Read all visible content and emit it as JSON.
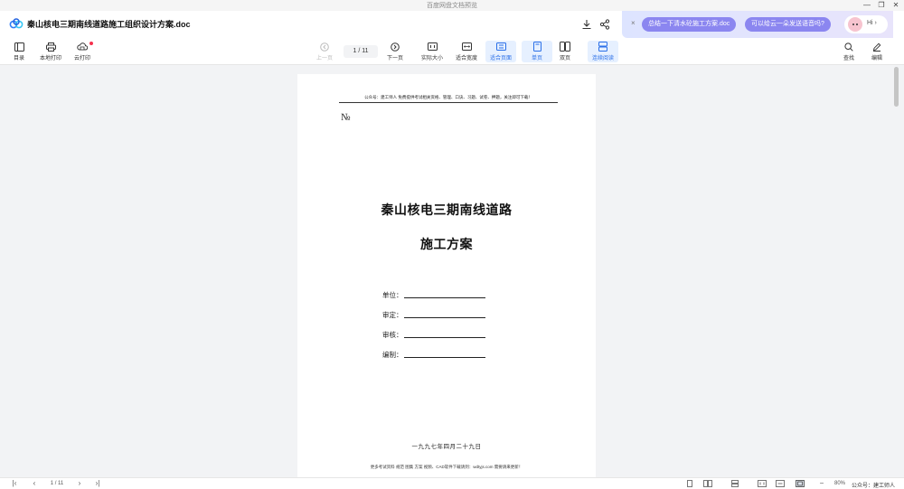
{
  "window": {
    "title": "百度网盘文档预览",
    "minimize": "—",
    "restore": "❐",
    "close": "✕"
  },
  "header": {
    "doc_title": "秦山核电三期南线道路施工组织设计方案.doc"
  },
  "ai_bar": {
    "close": "×",
    "chip1": "总结一下清水砼施工方案.doc",
    "chip2": "可以给云一朵发送语音吗?",
    "hi": "Hi ›"
  },
  "toolbar": {
    "toc": "目录",
    "local_print": "本地打印",
    "cloud_print": "云打印",
    "prev": "上一页",
    "page_indicator": "1 / 11",
    "next": "下一页",
    "actual_size": "实际大小",
    "fit_width": "适合宽度",
    "fit_page": "适合页面",
    "single": "单页",
    "double": "双页",
    "continuous": "连续阅读",
    "find": "查找",
    "edit": "编辑"
  },
  "page": {
    "header_text": "公众号：建工师人  免费提供考试相关资格、管理、口诀、习题、试卷、押题，关注即可下载！",
    "number_mark": "№",
    "title_line1": "秦山核电三期南线道路",
    "title_line2": "施工方案",
    "fields": [
      "单位：",
      "审定：",
      "审核：",
      "编制："
    ],
    "date": "一九九七年四月二十九日",
    "footer_text": "更多考试资料 规范 图集 方案 视频、CAD软件下载请到：wdtyjs.com 需要请来更新！"
  },
  "bottombar": {
    "first": "|‹",
    "prev": "‹",
    "page_indicator": "1 / 11",
    "next": "›",
    "last": "›|",
    "zoom_minus": "−",
    "zoom": "80%",
    "watermark": "公众号：建工师人"
  }
}
